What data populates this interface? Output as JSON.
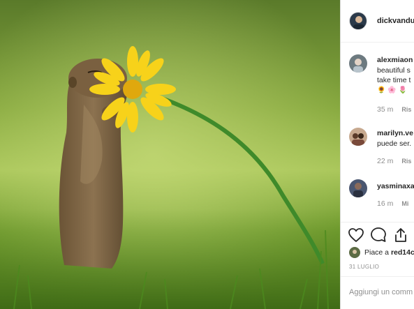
{
  "post": {
    "author": "dickvandu",
    "image_subject": "squirrel-smelling-yellow-flower"
  },
  "comments": [
    {
      "user": "alexmiaon",
      "lines": [
        "beautiful s",
        "take time t"
      ],
      "emoji": [
        "🌻",
        "🌸",
        "🌷"
      ],
      "time": "35 m",
      "reply": "Ris"
    },
    {
      "user": "marilyn.ve",
      "lines": [
        "puede ser."
      ],
      "time": "22 m",
      "reply": "Ris"
    },
    {
      "user": "yasminaxa",
      "lines": [],
      "time": "16 m",
      "reply": "Mi"
    }
  ],
  "likes": {
    "prefix": "Piace a ",
    "user": "red14c"
  },
  "date": "31 LUGLIO",
  "add_comment": {
    "placeholder": "Aggiungi un comm"
  },
  "icons": [
    "heart-icon",
    "comment-icon",
    "share-icon"
  ],
  "colors": {
    "text": "#262626",
    "muted": "#8e8e8e",
    "border": "#efefef",
    "flower": "#f7d21a",
    "stem": "#3f8a2a"
  }
}
